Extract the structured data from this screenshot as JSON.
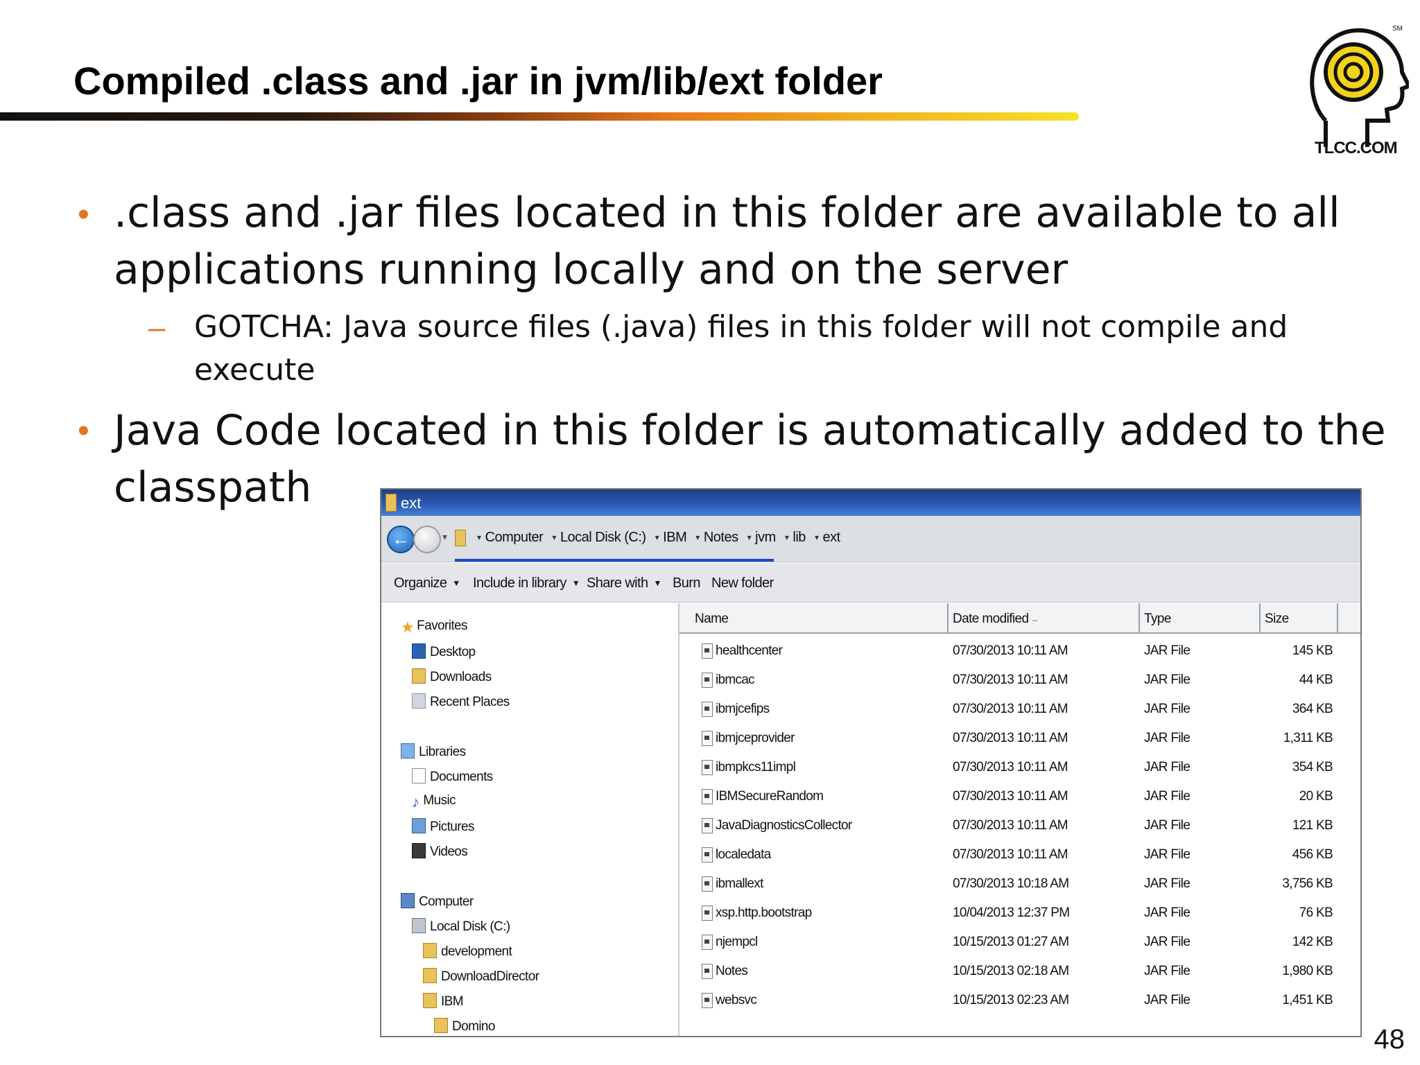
{
  "slide": {
    "title": "Compiled .class and .jar in jvm/lib/ext folder",
    "logo_text": "TLCC.COM",
    "logo_mark": "SM",
    "page_number": "48",
    "bullets": [
      {
        "text_line1": ".class and .jar files located in this folder are available to all",
        "text_line2": "applications running locally and on the server"
      },
      {
        "text_line1": "Java Code located in this folder is automatically added to the",
        "text_line2": "classpath"
      }
    ],
    "sub_bullet": {
      "marker": "–",
      "text_line1": "GOTCHA:  Java source files (.java) files in this folder will not compile and",
      "text_line2": "execute"
    }
  },
  "explorer": {
    "window_title": "ext",
    "breadcrumbs": [
      "Computer",
      "Local Disk (C:)",
      "IBM",
      "Notes",
      "jvm",
      "lib",
      "ext"
    ],
    "toolbar": {
      "organize": "Organize",
      "include_in_library": "Include in library",
      "share_with": "Share with",
      "burn": "Burn",
      "new_folder": "New folder"
    },
    "nav": {
      "favorites": "Favorites",
      "desktop": "Desktop",
      "downloads": "Downloads",
      "recent_places": "Recent Places",
      "libraries": "Libraries",
      "documents": "Documents",
      "music": "Music",
      "pictures": "Pictures",
      "videos": "Videos",
      "computer": "Computer",
      "local_disk": "Local Disk (C:)",
      "development": "development",
      "download_director": "DownloadDirector",
      "ibm": "IBM",
      "domino": "Domino"
    },
    "columns": {
      "name": "Name",
      "date_modified": "Date modified",
      "type": "Type",
      "size": "Size"
    },
    "files": [
      {
        "name": "healthcenter",
        "date": "07/30/2013 10:11 AM",
        "type": "JAR File",
        "size": "145 KB"
      },
      {
        "name": "ibmcac",
        "date": "07/30/2013 10:11 AM",
        "type": "JAR File",
        "size": "44 KB"
      },
      {
        "name": "ibmjcefips",
        "date": "07/30/2013 10:11 AM",
        "type": "JAR File",
        "size": "364 KB"
      },
      {
        "name": "ibmjceprovider",
        "date": "07/30/2013 10:11 AM",
        "type": "JAR File",
        "size": "1,311 KB"
      },
      {
        "name": "ibmpkcs11impl",
        "date": "07/30/2013 10:11 AM",
        "type": "JAR File",
        "size": "354 KB"
      },
      {
        "name": "IBMSecureRandom",
        "date": "07/30/2013 10:11 AM",
        "type": "JAR File",
        "size": "20 KB"
      },
      {
        "name": "JavaDiagnosticsCollector",
        "date": "07/30/2013 10:11 AM",
        "type": "JAR File",
        "size": "121 KB"
      },
      {
        "name": "localedata",
        "date": "07/30/2013 10:11 AM",
        "type": "JAR File",
        "size": "456 KB"
      },
      {
        "name": "ibmallext",
        "date": "07/30/2013 10:18 AM",
        "type": "JAR File",
        "size": "3,756 KB"
      },
      {
        "name": "xsp.http.bootstrap",
        "date": "10/04/2013 12:37 PM",
        "type": "JAR File",
        "size": "76 KB"
      },
      {
        "name": "njempcl",
        "date": "10/15/2013 01:27 AM",
        "type": "JAR File",
        "size": "142 KB"
      },
      {
        "name": "Notes",
        "date": "10/15/2013 02:18 AM",
        "type": "JAR File",
        "size": "1,980 KB"
      },
      {
        "name": "websvc",
        "date": "10/15/2013 02:23 AM",
        "type": "JAR File",
        "size": "1,451 KB"
      }
    ]
  },
  "colors": {
    "accent_orange": "#e3741e",
    "title_bar": "#1f3f88",
    "address_underline": "#1f46c8"
  }
}
